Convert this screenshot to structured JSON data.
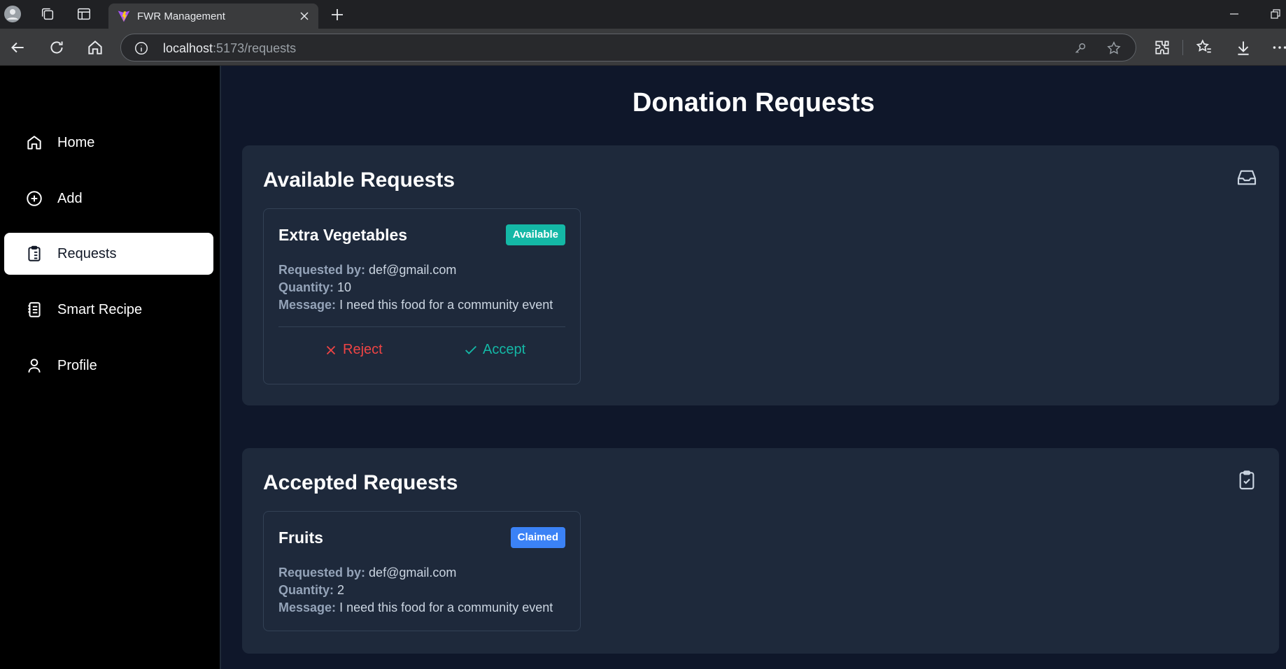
{
  "browser": {
    "tab_title": "FWR Management",
    "url_host": "localhost",
    "url_path": ":5173/requests"
  },
  "sidebar": {
    "items": [
      {
        "label": "Home",
        "icon": "home-icon",
        "active": false
      },
      {
        "label": "Add",
        "icon": "plus-circle-icon",
        "active": false
      },
      {
        "label": "Requests",
        "icon": "clipboard-list-icon",
        "active": true
      },
      {
        "label": "Smart Recipe",
        "icon": "notebook-icon",
        "active": false
      },
      {
        "label": "Profile",
        "icon": "user-icon",
        "active": false
      }
    ]
  },
  "page": {
    "title": "Donation Requests"
  },
  "available": {
    "heading": "Available Requests",
    "icon": "inbox-icon",
    "card": {
      "name": "Extra Vegetables",
      "badge": "Available",
      "requested_by_label": "Requested by:",
      "requested_by": "def@gmail.com",
      "quantity_label": "Quantity:",
      "quantity": "10",
      "message_label": "Message:",
      "message": "I need this food for a community event",
      "reject_label": "Reject",
      "accept_label": "Accept"
    }
  },
  "accepted": {
    "heading": "Accepted Requests",
    "icon": "clipboard-check-icon",
    "card": {
      "name": "Fruits",
      "badge": "Claimed",
      "requested_by_label": "Requested by:",
      "requested_by": "def@gmail.com",
      "quantity_label": "Quantity:",
      "quantity": "2",
      "message_label": "Message:",
      "message": "I need this food for a community event"
    }
  },
  "colors": {
    "available_badge": "#14b8a6",
    "claimed_badge": "#3b82f6",
    "reject": "#ef4444",
    "accept": "#14b8a6",
    "background": "#0f172a",
    "panel": "#1e293b"
  }
}
